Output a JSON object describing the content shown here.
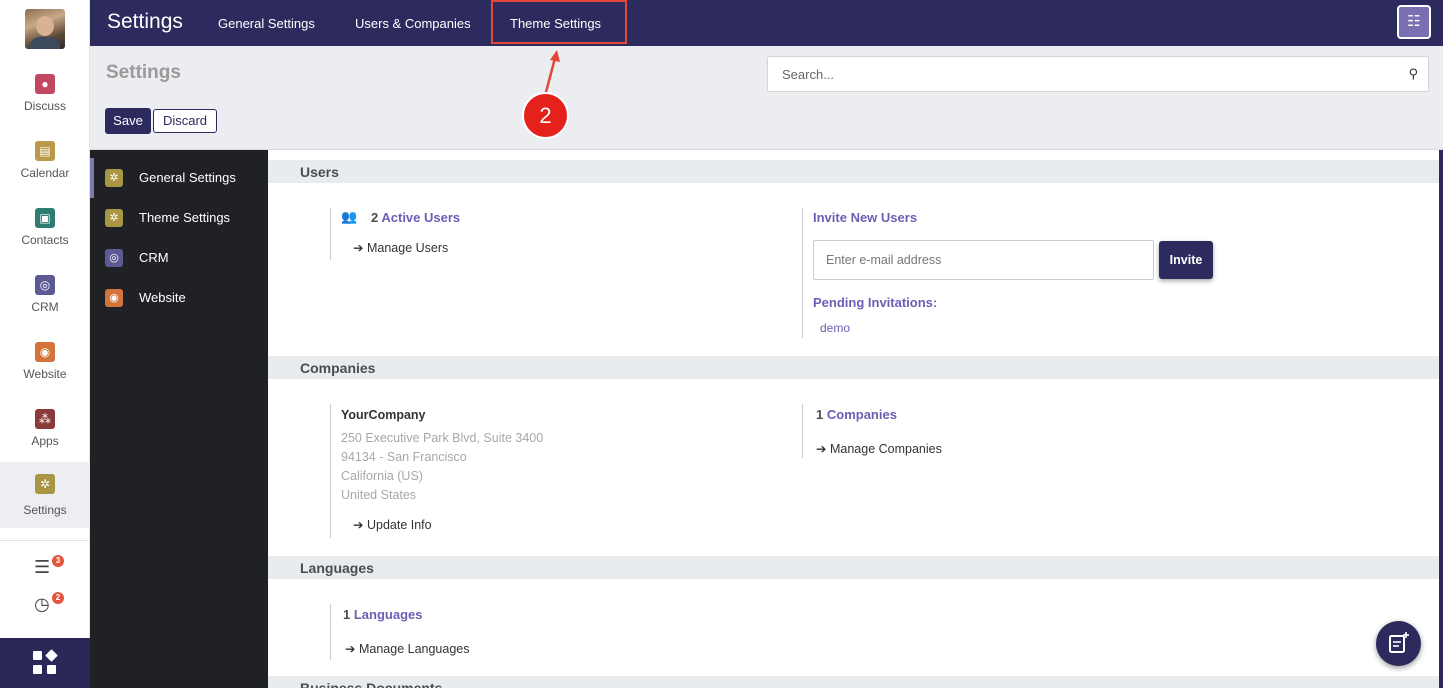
{
  "rail": {
    "items": [
      {
        "label": "Discuss",
        "icon": "discuss-icon",
        "color": "#c3475f"
      },
      {
        "label": "Calendar",
        "icon": "calendar-icon",
        "color": "#b89a48"
      },
      {
        "label": "Contacts",
        "icon": "contacts-icon",
        "color": "#2f7c72"
      },
      {
        "label": "CRM",
        "icon": "crm-icon",
        "color": "#5d5a93"
      },
      {
        "label": "Website",
        "icon": "website-icon",
        "color": "#d4733a"
      },
      {
        "label": "Apps",
        "icon": "apps-icon",
        "color": "#8a3a3a"
      },
      {
        "label": "Settings",
        "icon": "settings-icon",
        "color": "#a89645"
      }
    ],
    "messages_badge": "3",
    "activities_badge": "2"
  },
  "topbar": {
    "brand": "Settings",
    "links": [
      "General Settings",
      "Users & Companies",
      "Theme Settings"
    ]
  },
  "control_panel": {
    "title": "Settings",
    "save_label": "Save",
    "discard_label": "Discard",
    "search_placeholder": "Search..."
  },
  "annotation": {
    "number": "2"
  },
  "settings_sidebar": [
    {
      "label": "General Settings",
      "icon": "gear-icon",
      "color": "#a89645"
    },
    {
      "label": "Theme Settings",
      "icon": "gear-icon",
      "color": "#a89645"
    },
    {
      "label": "CRM",
      "icon": "crm-icon",
      "color": "#5d5a93"
    },
    {
      "label": "Website",
      "icon": "globe-icon",
      "color": "#d4733a"
    }
  ],
  "users": {
    "section_title": "Users",
    "active_count": "2",
    "active_label": "Active Users",
    "manage_link": "Manage Users",
    "invite_title": "Invite New Users",
    "invite_placeholder": "Enter e-mail address",
    "invite_button": "Invite",
    "pending_title": "Pending Invitations:",
    "pending": [
      "demo"
    ]
  },
  "companies": {
    "section_title": "Companies",
    "company_name": "YourCompany",
    "address": [
      "250 Executive Park Blvd, Suite 3400",
      "94134 - San Francisco",
      "California (US)",
      "United States"
    ],
    "update_link": "Update Info",
    "count": "1",
    "count_label": "Companies",
    "manage_link": "Manage Companies"
  },
  "languages": {
    "section_title": "Languages",
    "count": "1",
    "count_label": "Languages",
    "manage_link": "Manage Languages"
  },
  "business_documents": {
    "section_title": "Business Documents"
  },
  "colors": {
    "primary": "#2d2b5e",
    "accent": "#6b5fb5",
    "annotation": "#e5211b"
  }
}
